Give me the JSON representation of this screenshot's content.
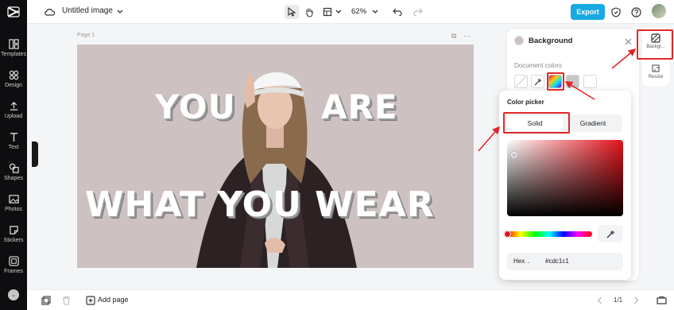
{
  "sidebar": {
    "items": [
      {
        "label": "Templates",
        "icon": "templates-icon"
      },
      {
        "label": "Design",
        "icon": "design-icon"
      },
      {
        "label": "Upload",
        "icon": "upload-icon"
      },
      {
        "label": "Text",
        "icon": "text-icon"
      },
      {
        "label": "Shapes",
        "icon": "shapes-icon"
      },
      {
        "label": "Photos",
        "icon": "photos-icon"
      },
      {
        "label": "Stickers",
        "icon": "stickers-icon"
      },
      {
        "label": "Frames",
        "icon": "frames-icon"
      }
    ]
  },
  "topbar": {
    "title": "Untitled image",
    "zoom": "62%",
    "export_label": "Export"
  },
  "canvas": {
    "page_label": "Page 1",
    "line1_left": "YOU",
    "line1_right": "ARE",
    "line2": "WHAT YOU WEAR",
    "background_color": "#cdc1c1"
  },
  "bottombar": {
    "add_page_label": "Add page",
    "pager": "1/1"
  },
  "right_rail": {
    "background_label": "Backgr...",
    "resize_label": "Resize"
  },
  "background_panel": {
    "title": "Background",
    "document_colors_label": "Document colors",
    "swatches": [
      "none",
      "eyedropper",
      "gradient",
      "#c7c7c7",
      "#ffffff"
    ]
  },
  "color_picker": {
    "title": "Color picker",
    "solid_label": "Solid",
    "gradient_label": "Gradient",
    "hex_mode": "Hex",
    "hex_value": "#cdc1c1",
    "hue_color": "#e4121b"
  },
  "annotation_color": "#e32626"
}
